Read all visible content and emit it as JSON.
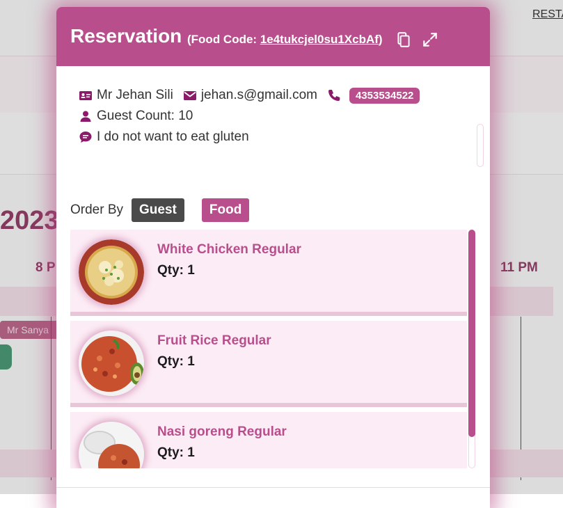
{
  "background": {
    "year_fragment": "2023",
    "time_left": "8 P",
    "time_right": "11 PM",
    "chip_label": "Mr Sanya",
    "top_link": "RESTA"
  },
  "modal": {
    "title": "Reservation",
    "code_prefix": "(Food Code: ",
    "food_code": "1e4tukcjel0su1XcbAf",
    "code_suffix": ")",
    "copy_icon": "copy-icon",
    "expand_icon": "expand-icon"
  },
  "guest": {
    "name": "Mr Jehan Sili",
    "email": "jehan.s@gmail.com",
    "phone": "4353534522",
    "guest_count": "Guest Count: 10",
    "note": "I do not want to eat gluten"
  },
  "order_by": {
    "label": "Order By",
    "guest_button": "Guest",
    "food_button": "Food",
    "active": "Food"
  },
  "items": [
    {
      "name": "White Chicken Regular",
      "qty": "Qty: 1",
      "image": "egg-drop-soup"
    },
    {
      "name": "Fruit Rice Regular",
      "qty": "Qty: 1",
      "image": "fried-rice"
    },
    {
      "name": "Nasi goreng Regular",
      "qty": "Qty: 1",
      "image": "nasi-goreng"
    }
  ],
  "colors": {
    "brand": "#b84f8c",
    "card_bg": "#fcecf5",
    "dark_button": "#4a4a4a"
  }
}
